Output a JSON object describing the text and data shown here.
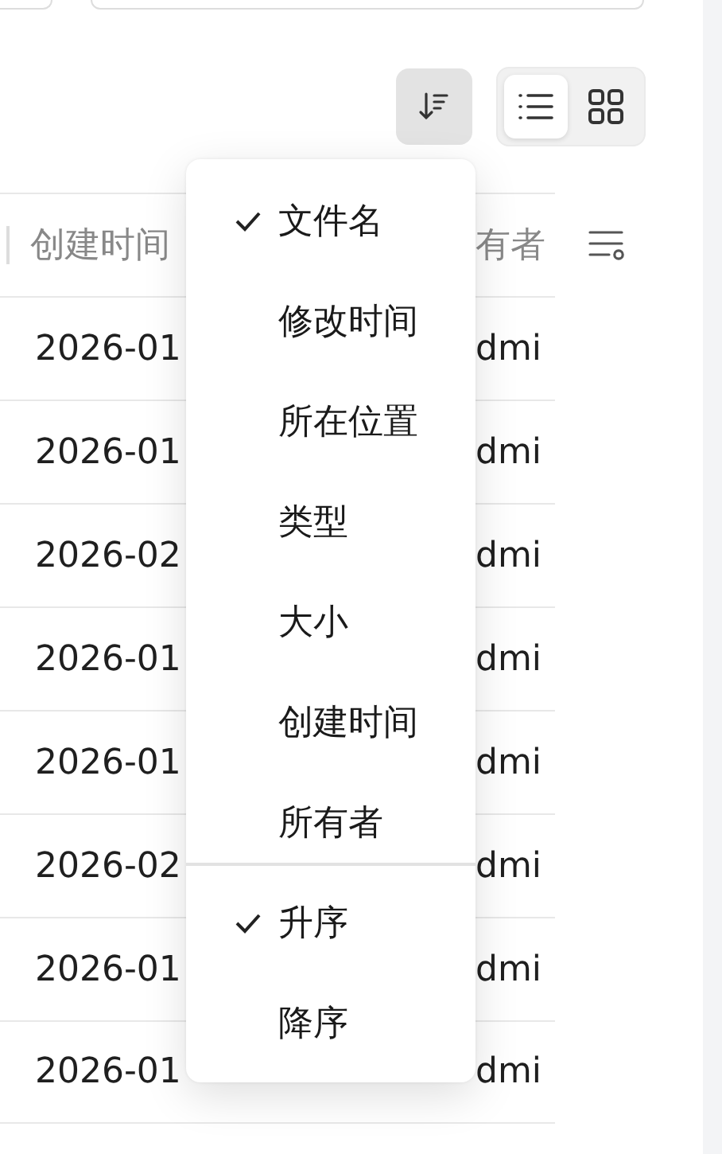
{
  "toolbar": {
    "sort_button": {
      "pressed": true
    },
    "views": [
      {
        "kind": "list",
        "selected": true
      },
      {
        "kind": "grid",
        "selected": false
      }
    ]
  },
  "table": {
    "columns": [
      {
        "label": "创建时间"
      },
      {
        "label": "有者"
      }
    ],
    "rows": [
      [
        "2026-01",
        "dmi"
      ],
      [
        "2026-01",
        "dmi"
      ],
      [
        "2026-02",
        "dmi"
      ],
      [
        "2026-01",
        "dmi"
      ],
      [
        "2026-01",
        "dmi"
      ],
      [
        "2026-02",
        "dmi"
      ],
      [
        "2026-01",
        "dmi"
      ],
      [
        "2026-01",
        "dmi"
      ]
    ]
  },
  "sort_menu": {
    "fields": [
      {
        "label": "文件名",
        "selected": true
      },
      {
        "label": "修改时间",
        "selected": false
      },
      {
        "label": "所在位置",
        "selected": false
      },
      {
        "label": "类型",
        "selected": false
      },
      {
        "label": "大小",
        "selected": false
      },
      {
        "label": "创建时间",
        "selected": false
      },
      {
        "label": "所有者",
        "selected": false
      }
    ],
    "orders": [
      {
        "label": "升序",
        "selected": true
      },
      {
        "label": "降序",
        "selected": false
      }
    ]
  }
}
